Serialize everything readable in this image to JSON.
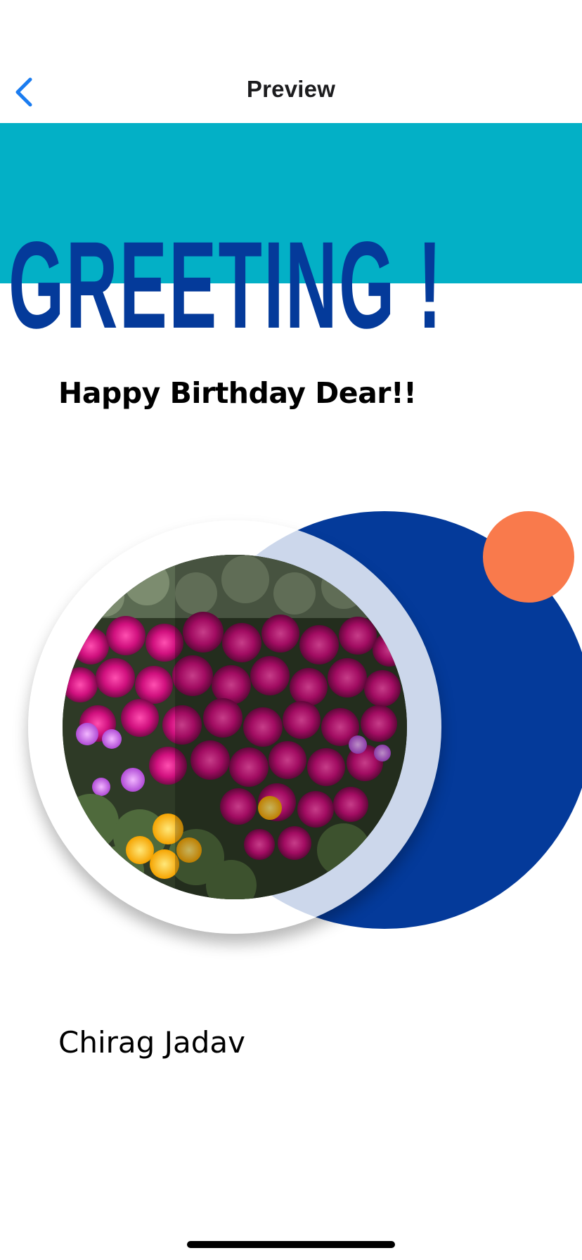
{
  "nav": {
    "title": "Preview",
    "back_icon": "chevron-left-icon"
  },
  "card": {
    "heading": "GREETING !",
    "message": "Happy Birthday Dear!!",
    "author": "Chirag Jadav",
    "photo_subject": "flowers",
    "colors": {
      "band": "#03b0c6",
      "heading": "#043a9a",
      "blue_circle": "#043a9a",
      "orange_dot": "#f97a4c",
      "accent_back": "#1a7cf0"
    }
  }
}
